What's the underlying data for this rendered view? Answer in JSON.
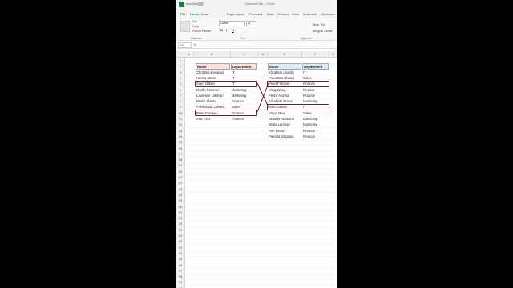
{
  "titlebar": {
    "autosave": "AutoSave",
    "title": "Document title — Excel"
  },
  "menu": [
    "File",
    "Home",
    "Draw",
    "Page Layout",
    "Formulas",
    "Data",
    "Review",
    "View",
    "Automate",
    "Developer"
  ],
  "ribbon": {
    "cut": "Cut",
    "copy": "Copy",
    "format_painter": "Format Painter",
    "font": "Calibri",
    "size": "11",
    "wrap": "Wrap Text",
    "merge": "Merge & Center",
    "groups": {
      "clipboard": "Clipboard",
      "font": "Font",
      "alignment": "Alignment"
    },
    "bold": "B",
    "italic": "I",
    "underline": "U"
  },
  "formula": {
    "namebox": "A3",
    "fx": "fx"
  },
  "columns": [
    "A",
    "B",
    "C",
    "D",
    "E",
    "F",
    "G"
  ],
  "rows": [
    "1",
    "2",
    "3",
    "4",
    "5",
    "6",
    "7",
    "8",
    "9",
    "10",
    "11",
    "12",
    "13",
    "14",
    "15",
    "16",
    "17",
    "18",
    "19",
    "20",
    "21",
    "22",
    "23",
    "24",
    "25",
    "26",
    "27",
    "28",
    "29",
    "30",
    "31",
    "32",
    "33",
    "34",
    "35",
    "36",
    "37",
    "38",
    "39",
    "40"
  ],
  "left_table": {
    "headers": [
      "Name",
      "Department"
    ],
    "rows": [
      [
        "Christina Berglund",
        "IT"
      ],
      [
        "Hanna Moos",
        "IT"
      ],
      [
        "Sven Ottlieb",
        "IT"
      ],
      [
        "Martin Sommer",
        "Marketing"
      ],
      [
        "Laurence Lebihan",
        "Marketing"
      ],
      [
        "Pedro Afonso",
        "Finance"
      ],
      [
        "Frédérique Citeaux",
        "Sales"
      ],
      [
        "Peter Franken",
        "Finance"
      ],
      [
        "Ana Cruz",
        "Finance"
      ]
    ]
  },
  "right_table": {
    "headers": [
      "Name",
      "Department"
    ],
    "rows": [
      [
        "Elizabeth Lincoln",
        "IT"
      ],
      [
        "Francisco Chang",
        "Sales"
      ],
      [
        "Peter Franken",
        "Finance"
      ],
      [
        "Yang Wang",
        "Finance"
      ],
      [
        "Pedro Afonso",
        "Finance"
      ],
      [
        "Elizabeth Brown",
        "Marketing"
      ],
      [
        "Sven Ottlieb",
        "IT"
      ],
      [
        "Diego Roel",
        "Sales"
      ],
      [
        "Victoria Ashworth",
        "Marketing"
      ],
      [
        "Maria Larsson",
        "Marketing"
      ],
      [
        "Ann Devon",
        "Finance"
      ],
      [
        "Patricio Simpson",
        "Finance"
      ]
    ]
  },
  "colors": {
    "accent": "#107c41",
    "highlight": "#7a1a2a",
    "left_header": "#fde0dc",
    "right_header": "#dde9f7"
  }
}
